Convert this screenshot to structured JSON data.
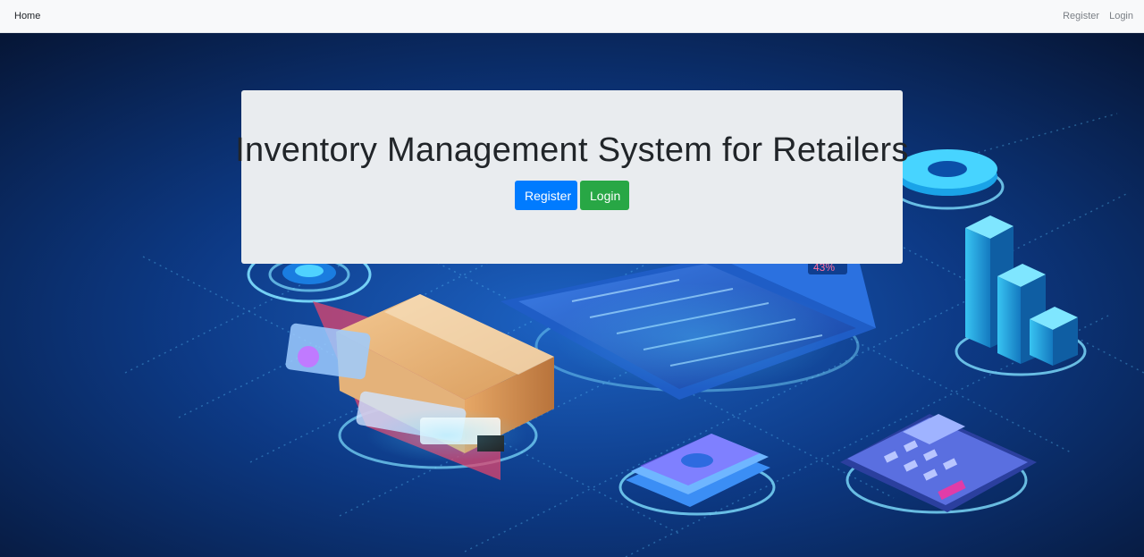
{
  "navbar": {
    "home_label": "Home",
    "register_label": "Register",
    "login_label": "Login"
  },
  "jumbotron": {
    "title": "Inventory Management System for Retailers",
    "register_button": "Register",
    "login_button": "Login"
  },
  "hero": {
    "illustration": "inventory-isometric-illustration",
    "percent_badge": "43%"
  },
  "colors": {
    "navbar_bg": "#f8f9fa",
    "jumbotron_bg": "#e9ecef",
    "primary": "#007bff",
    "success": "#28a745",
    "hero_bg": "#0a1f4a"
  }
}
